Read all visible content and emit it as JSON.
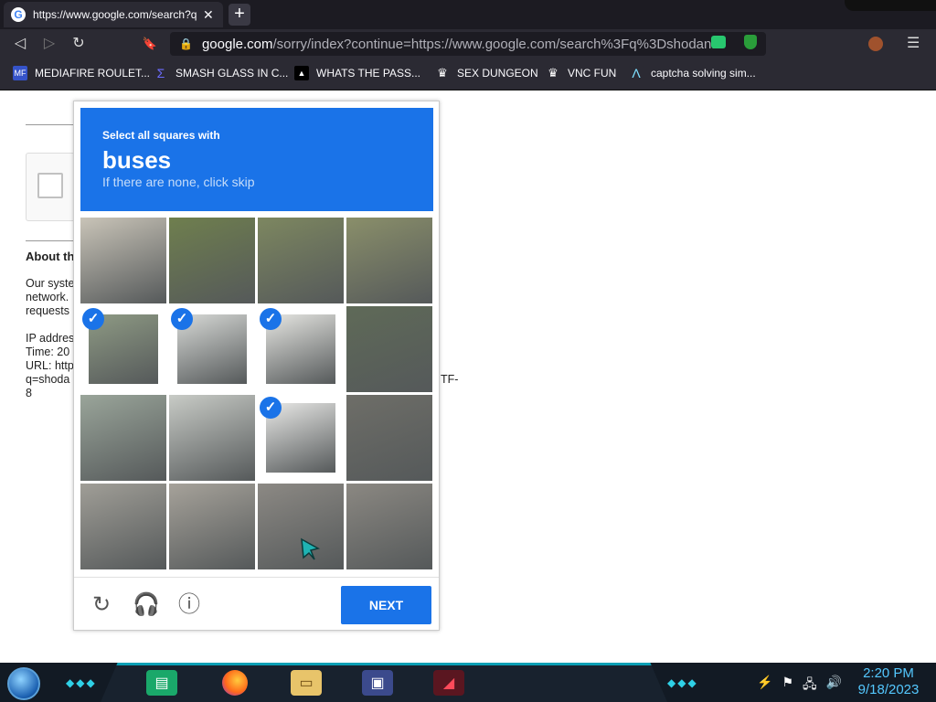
{
  "browser": {
    "tab_title": "https://www.google.com/search?q",
    "tab_close": "✕",
    "new_tab": "+",
    "url_host": "google.com",
    "url_rest": "/sorry/index?continue=https://www.google.com/search%3Fq%3Dshodan...",
    "back": "◁",
    "forward": "▷",
    "reload": "↻",
    "bookmark": "🔖",
    "menu": "☰"
  },
  "bookmarks": [
    {
      "label": "MEDIAFIRE ROULET...",
      "icon": "MF"
    },
    {
      "label": "SMASH GLASS IN C...",
      "icon": "Σ"
    },
    {
      "label": "WHATS THE PASS...",
      "icon": "▲"
    },
    {
      "label": "SEX DUNGEON",
      "icon": "♛"
    },
    {
      "label": "VNC FUN",
      "icon": "♛"
    },
    {
      "label": "captcha solving sim...",
      "icon": "Λ"
    }
  ],
  "page": {
    "about_heading": "About th",
    "para_lines": [
      "Our syste",
      "network.",
      "requests"
    ],
    "ip_lines": [
      "IP addres",
      "Time: 20",
      "URL: http",
      "q=shoda"
    ],
    "tail_tf": "TF-",
    "tail_8": "8"
  },
  "captcha": {
    "instruction": "Select all squares with",
    "target": "buses",
    "hint": "If there are none, click skip",
    "check_mark": "✓",
    "tiles": [
      {
        "selected": false,
        "color": "#c9c4b8"
      },
      {
        "selected": false,
        "color": "#6f7f4e"
      },
      {
        "selected": false,
        "color": "#7d8760"
      },
      {
        "selected": false,
        "color": "#8a8f6a"
      },
      {
        "selected": true,
        "color": "#8e9a84"
      },
      {
        "selected": true,
        "color": "#d7d9d6"
      },
      {
        "selected": true,
        "color": "#e6e6e2"
      },
      {
        "selected": false,
        "color": "#5f6a58"
      },
      {
        "selected": false,
        "color": "#9aa59a"
      },
      {
        "selected": false,
        "color": "#c8cbc6"
      },
      {
        "selected": true,
        "color": "#e8e8e6"
      },
      {
        "selected": false,
        "color": "#6e6e68"
      },
      {
        "selected": false,
        "color": "#a09e97"
      },
      {
        "selected": false,
        "color": "#a6a29a"
      },
      {
        "selected": false,
        "color": "#8c8984"
      },
      {
        "selected": false,
        "color": "#8b8882"
      }
    ],
    "reload_icon": "↻",
    "audio_icon": "🎧",
    "info_icon": "ⓘ",
    "next_label": "NEXT"
  },
  "taskbar": {
    "time": "2:20 PM",
    "date": "9/18/2023",
    "tray_icons": [
      "⚡",
      "⚑",
      "🖧",
      "🔊"
    ]
  },
  "colors": {
    "captcha_blue": "#1a73e8",
    "accent_cyan": "#2fd0e6"
  }
}
